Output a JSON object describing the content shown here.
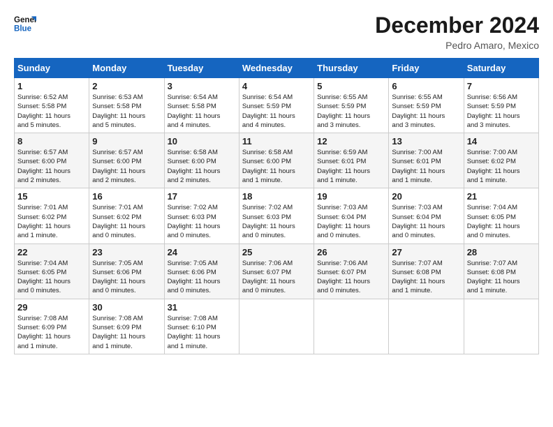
{
  "header": {
    "logo_line1": "General",
    "logo_line2": "Blue",
    "month": "December 2024",
    "location": "Pedro Amaro, Mexico"
  },
  "days_of_week": [
    "Sunday",
    "Monday",
    "Tuesday",
    "Wednesday",
    "Thursday",
    "Friday",
    "Saturday"
  ],
  "weeks": [
    [
      {
        "day": 1,
        "lines": [
          "Sunrise: 6:52 AM",
          "Sunset: 5:58 PM",
          "Daylight: 11 hours",
          "and 5 minutes."
        ]
      },
      {
        "day": 2,
        "lines": [
          "Sunrise: 6:53 AM",
          "Sunset: 5:58 PM",
          "Daylight: 11 hours",
          "and 5 minutes."
        ]
      },
      {
        "day": 3,
        "lines": [
          "Sunrise: 6:54 AM",
          "Sunset: 5:58 PM",
          "Daylight: 11 hours",
          "and 4 minutes."
        ]
      },
      {
        "day": 4,
        "lines": [
          "Sunrise: 6:54 AM",
          "Sunset: 5:59 PM",
          "Daylight: 11 hours",
          "and 4 minutes."
        ]
      },
      {
        "day": 5,
        "lines": [
          "Sunrise: 6:55 AM",
          "Sunset: 5:59 PM",
          "Daylight: 11 hours",
          "and 3 minutes."
        ]
      },
      {
        "day": 6,
        "lines": [
          "Sunrise: 6:55 AM",
          "Sunset: 5:59 PM",
          "Daylight: 11 hours",
          "and 3 minutes."
        ]
      },
      {
        "day": 7,
        "lines": [
          "Sunrise: 6:56 AM",
          "Sunset: 5:59 PM",
          "Daylight: 11 hours",
          "and 3 minutes."
        ]
      }
    ],
    [
      {
        "day": 8,
        "lines": [
          "Sunrise: 6:57 AM",
          "Sunset: 6:00 PM",
          "Daylight: 11 hours",
          "and 2 minutes."
        ]
      },
      {
        "day": 9,
        "lines": [
          "Sunrise: 6:57 AM",
          "Sunset: 6:00 PM",
          "Daylight: 11 hours",
          "and 2 minutes."
        ]
      },
      {
        "day": 10,
        "lines": [
          "Sunrise: 6:58 AM",
          "Sunset: 6:00 PM",
          "Daylight: 11 hours",
          "and 2 minutes."
        ]
      },
      {
        "day": 11,
        "lines": [
          "Sunrise: 6:58 AM",
          "Sunset: 6:00 PM",
          "Daylight: 11 hours",
          "and 1 minute."
        ]
      },
      {
        "day": 12,
        "lines": [
          "Sunrise: 6:59 AM",
          "Sunset: 6:01 PM",
          "Daylight: 11 hours",
          "and 1 minute."
        ]
      },
      {
        "day": 13,
        "lines": [
          "Sunrise: 7:00 AM",
          "Sunset: 6:01 PM",
          "Daylight: 11 hours",
          "and 1 minute."
        ]
      },
      {
        "day": 14,
        "lines": [
          "Sunrise: 7:00 AM",
          "Sunset: 6:02 PM",
          "Daylight: 11 hours",
          "and 1 minute."
        ]
      }
    ],
    [
      {
        "day": 15,
        "lines": [
          "Sunrise: 7:01 AM",
          "Sunset: 6:02 PM",
          "Daylight: 11 hours",
          "and 1 minute."
        ]
      },
      {
        "day": 16,
        "lines": [
          "Sunrise: 7:01 AM",
          "Sunset: 6:02 PM",
          "Daylight: 11 hours",
          "and 0 minutes."
        ]
      },
      {
        "day": 17,
        "lines": [
          "Sunrise: 7:02 AM",
          "Sunset: 6:03 PM",
          "Daylight: 11 hours",
          "and 0 minutes."
        ]
      },
      {
        "day": 18,
        "lines": [
          "Sunrise: 7:02 AM",
          "Sunset: 6:03 PM",
          "Daylight: 11 hours",
          "and 0 minutes."
        ]
      },
      {
        "day": 19,
        "lines": [
          "Sunrise: 7:03 AM",
          "Sunset: 6:04 PM",
          "Daylight: 11 hours",
          "and 0 minutes."
        ]
      },
      {
        "day": 20,
        "lines": [
          "Sunrise: 7:03 AM",
          "Sunset: 6:04 PM",
          "Daylight: 11 hours",
          "and 0 minutes."
        ]
      },
      {
        "day": 21,
        "lines": [
          "Sunrise: 7:04 AM",
          "Sunset: 6:05 PM",
          "Daylight: 11 hours",
          "and 0 minutes."
        ]
      }
    ],
    [
      {
        "day": 22,
        "lines": [
          "Sunrise: 7:04 AM",
          "Sunset: 6:05 PM",
          "Daylight: 11 hours",
          "and 0 minutes."
        ]
      },
      {
        "day": 23,
        "lines": [
          "Sunrise: 7:05 AM",
          "Sunset: 6:06 PM",
          "Daylight: 11 hours",
          "and 0 minutes."
        ]
      },
      {
        "day": 24,
        "lines": [
          "Sunrise: 7:05 AM",
          "Sunset: 6:06 PM",
          "Daylight: 11 hours",
          "and 0 minutes."
        ]
      },
      {
        "day": 25,
        "lines": [
          "Sunrise: 7:06 AM",
          "Sunset: 6:07 PM",
          "Daylight: 11 hours",
          "and 0 minutes."
        ]
      },
      {
        "day": 26,
        "lines": [
          "Sunrise: 7:06 AM",
          "Sunset: 6:07 PM",
          "Daylight: 11 hours",
          "and 0 minutes."
        ]
      },
      {
        "day": 27,
        "lines": [
          "Sunrise: 7:07 AM",
          "Sunset: 6:08 PM",
          "Daylight: 11 hours",
          "and 1 minute."
        ]
      },
      {
        "day": 28,
        "lines": [
          "Sunrise: 7:07 AM",
          "Sunset: 6:08 PM",
          "Daylight: 11 hours",
          "and 1 minute."
        ]
      }
    ],
    [
      {
        "day": 29,
        "lines": [
          "Sunrise: 7:08 AM",
          "Sunset: 6:09 PM",
          "Daylight: 11 hours",
          "and 1 minute."
        ]
      },
      {
        "day": 30,
        "lines": [
          "Sunrise: 7:08 AM",
          "Sunset: 6:09 PM",
          "Daylight: 11 hours",
          "and 1 minute."
        ]
      },
      {
        "day": 31,
        "lines": [
          "Sunrise: 7:08 AM",
          "Sunset: 6:10 PM",
          "Daylight: 11 hours",
          "and 1 minute."
        ]
      },
      null,
      null,
      null,
      null
    ]
  ]
}
